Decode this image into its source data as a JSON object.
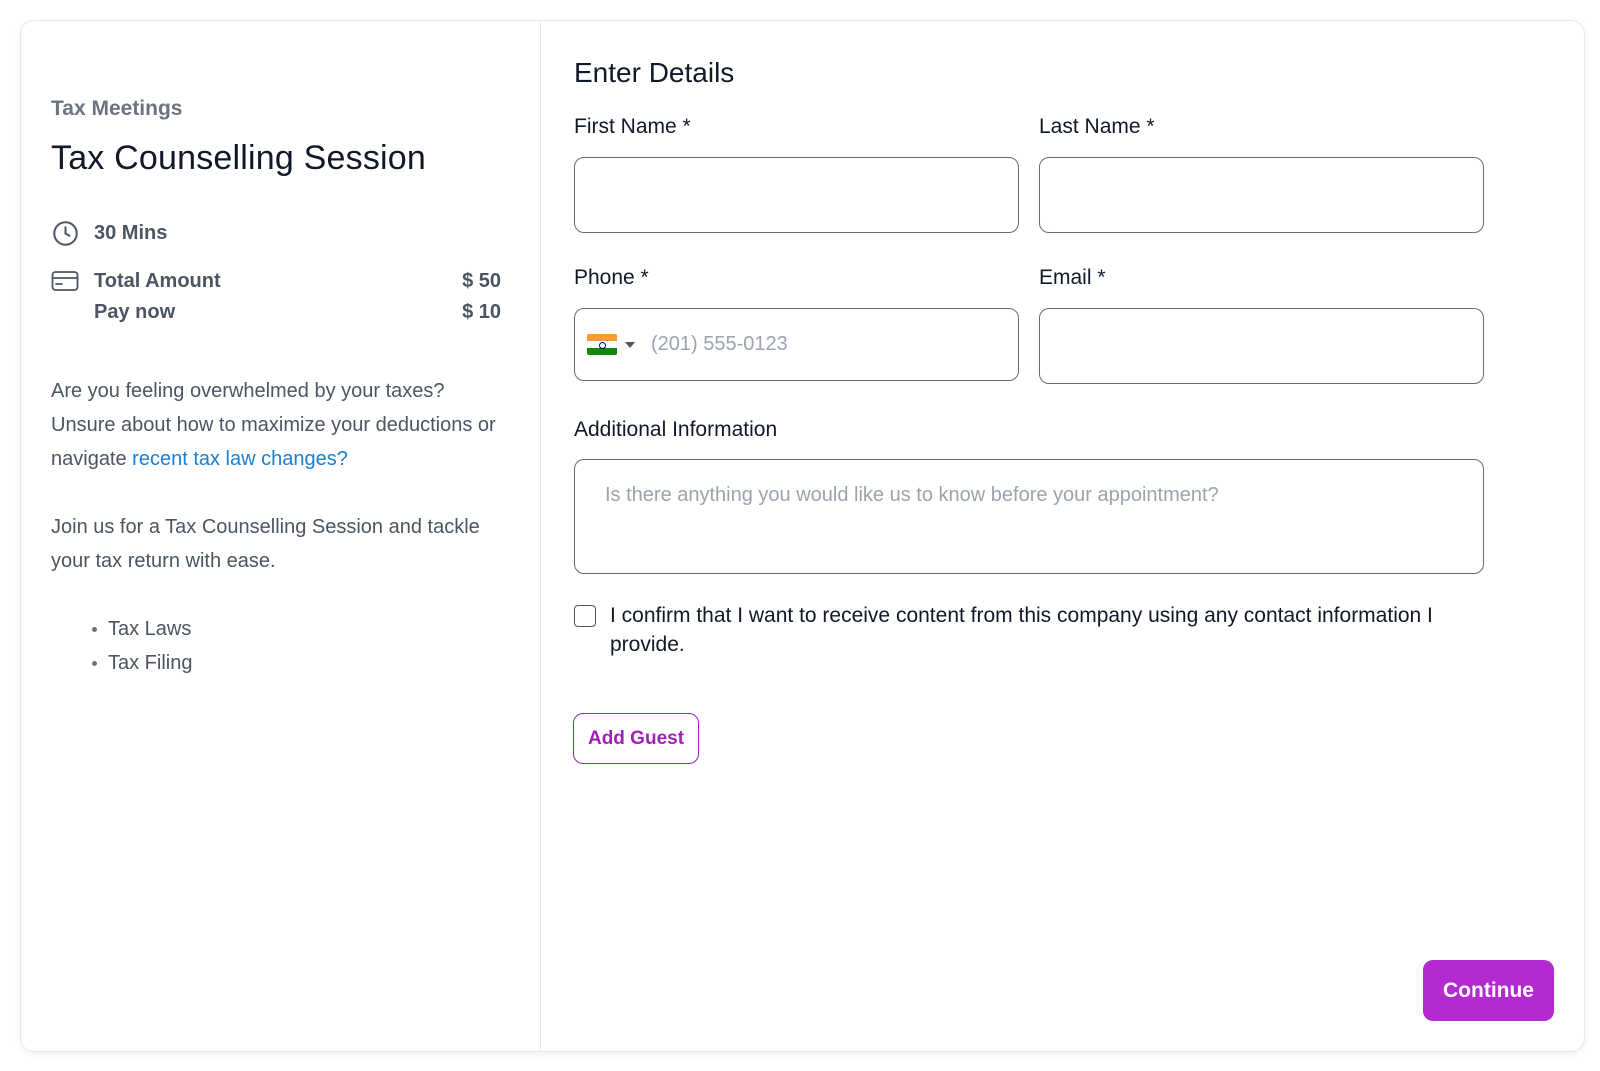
{
  "event": {
    "category": "Tax Meetings",
    "title": "Tax Counselling Session",
    "duration": "30 Mins",
    "total_amount_label": "Total Amount",
    "total_amount_value": "$ 50",
    "pay_now_label": "Pay now",
    "pay_now_value": "$ 10"
  },
  "description": {
    "para1_text": "Are you feeling overwhelmed by your taxes? Unsure about how to maximize your deductions or navigate ",
    "para1_link": "recent tax law changes?",
    "para2": "Join us for a Tax Counselling Session and tackle your tax return with ease.",
    "topics": [
      "Tax Laws",
      "Tax Filing"
    ]
  },
  "form": {
    "title": "Enter Details",
    "first_name_label": "First Name *",
    "first_name_value": "",
    "last_name_label": "Last Name *",
    "last_name_value": "",
    "phone_label": "Phone *",
    "phone_placeholder": "(201) 555-0123",
    "phone_country": "India",
    "email_label": "Email *",
    "email_value": "",
    "additional_label": "Additional Information",
    "additional_placeholder": "Is there anything you would like us to know before your appointment?",
    "consent_text": "I confirm that I want to receive content from this company using any contact information I provide.",
    "consent_checked": false,
    "add_guest_label": "Add Guest",
    "continue_label": "Continue"
  },
  "colors": {
    "accent": "#b22ad0",
    "link": "#1a7fd1"
  },
  "icons": {
    "duration": "clock-icon",
    "amount": "credit-card-icon",
    "country_dropdown": "chevron-down-icon"
  }
}
